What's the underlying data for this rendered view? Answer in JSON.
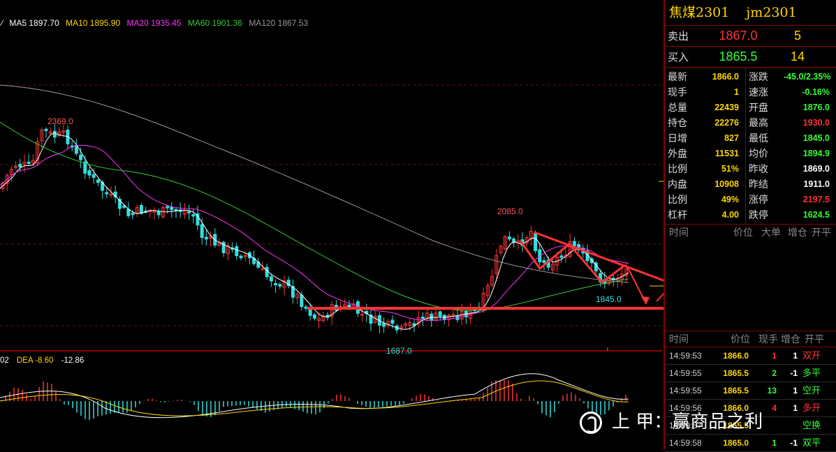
{
  "ma_legend": {
    "ma5": "MA5 1897.70",
    "ma10": "MA10 1895.90",
    "ma20": "MA20 1935.45",
    "ma60": "MA60 1901.36",
    "ma120": "MA120 1867.53",
    "colors": {
      "ma5": "#ffffff",
      "ma10": "#ffd700",
      "ma20": "#ff33ff",
      "ma60": "#33cc33",
      "ma120": "#999999"
    }
  },
  "macd_legend": {
    "dif": "02",
    "dea": "DEA -8.60",
    "macd": "-12.86"
  },
  "price_labels": {
    "high1": "2369.0",
    "high2": "2085.0",
    "low1": "1687.0",
    "low2": "1845.0"
  },
  "instrument": {
    "name": "焦煤2301",
    "code": "jm2301"
  },
  "sell": {
    "label": "卖出",
    "price": "1867.0",
    "volume": "5"
  },
  "buy": {
    "label": "买入",
    "price": "1865.5",
    "volume": "14"
  },
  "stats": [
    {
      "k": "最新",
      "v": "1866.0",
      "k2": "涨跌",
      "v2": "-45.0/2.35%",
      "c2": "#33ff33"
    },
    {
      "k": "现手",
      "v": "1",
      "k2": "速涨",
      "v2": "-0.16%",
      "c2": "#33ff33"
    },
    {
      "k": "总量",
      "v": "22439",
      "k2": "开盘",
      "v2": "1876.0",
      "c2": "#33ff33"
    },
    {
      "k": "持仓",
      "v": "22276",
      "k2": "最高",
      "v2": "1930.0",
      "c2": "#ff3333"
    },
    {
      "k": "日增",
      "v": "827",
      "k2": "最低",
      "v2": "1845.0",
      "c2": "#33ff33"
    },
    {
      "k": "外盘",
      "v": "11531",
      "k2": "均价",
      "v2": "1894.9",
      "c2": "#33ff33"
    },
    {
      "k": "比例",
      "v": "51%",
      "k2": "昨收",
      "v2": "1869.0",
      "c2": "#ffffff"
    },
    {
      "k": "内盘",
      "v": "10908",
      "k2": "昨结",
      "v2": "1911.0",
      "c2": "#ffffff"
    },
    {
      "k": "比例",
      "v": "49%",
      "k2": "涨停",
      "v2": "2197.5",
      "c2": "#ff3333"
    },
    {
      "k": "杠杆",
      "v": "4.00",
      "k2": "跌停",
      "v2": "1624.5",
      "c2": "#33ff33"
    }
  ],
  "big_order_header": {
    "time": "时间",
    "price": "价位",
    "big": "大单",
    "add": "增仓",
    "openclose": "开平"
  },
  "tick_header": {
    "time": "时间",
    "price": "价位",
    "vol": "现手",
    "add": "增仓",
    "openclose": "开平"
  },
  "ticks": [
    {
      "time": "14:59:53",
      "price": "1866.0",
      "vol": "1",
      "vc": "#ff3333",
      "add": "1",
      "oc": "双开",
      "occ": "#ff3333"
    },
    {
      "time": "14:59:55",
      "price": "1865.5",
      "vol": "2",
      "vc": "#33ff33",
      "add": "-1",
      "oc": "多平",
      "occ": "#33ff33"
    },
    {
      "time": "14:59:55",
      "price": "1865.5",
      "vol": "13",
      "vc": "#33ff33",
      "add": "1",
      "oc": "空开",
      "occ": "#33ff33"
    },
    {
      "time": "14:59:56",
      "price": "1866.0",
      "vol": "4",
      "vc": "#ff3333",
      "add": "1",
      "oc": "多开",
      "occ": "#ff3333"
    },
    {
      "time": "14:59:57",
      "price": "1865.5",
      "vol": "",
      "vc": "#33ff33",
      "add": "",
      "oc": "空换",
      "occ": "#33ff33"
    },
    {
      "time": "14:59:58",
      "price": "1865.0",
      "vol": "1",
      "vc": "#33ff33",
      "add": "-1",
      "oc": "双平",
      "occ": "#33ff33"
    }
  ],
  "watermark": "上 甲：赢商品之利"
}
